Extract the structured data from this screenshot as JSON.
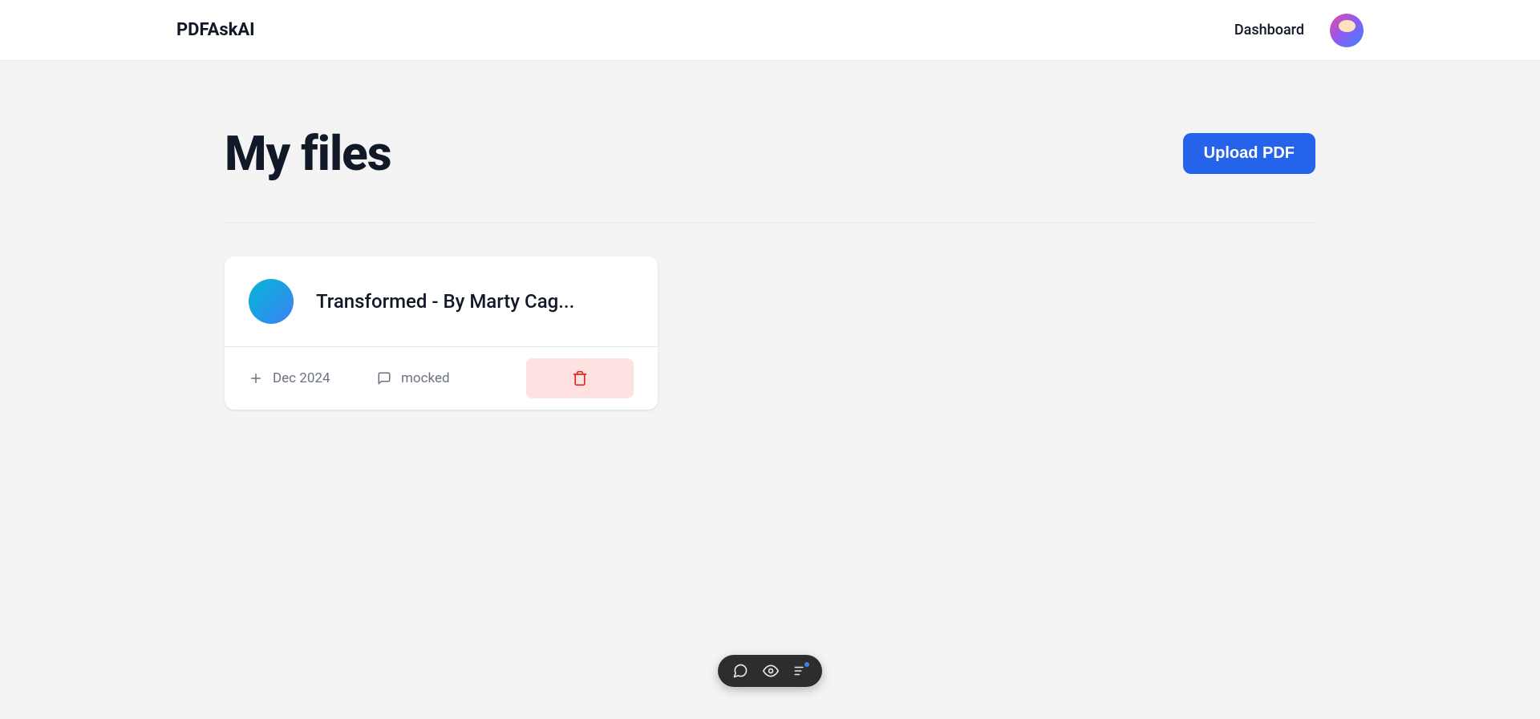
{
  "header": {
    "logo": "PDFAskAI",
    "nav": {
      "dashboard": "Dashboard"
    }
  },
  "page": {
    "title": "My files",
    "upload_button": "Upload PDF"
  },
  "files": [
    {
      "name": "Transformed - By Marty Cag...",
      "date": "Dec 2024",
      "status": "mocked"
    }
  ],
  "colors": {
    "primary": "#2563eb",
    "danger_bg": "#fee2e2",
    "danger": "#dc2626"
  }
}
